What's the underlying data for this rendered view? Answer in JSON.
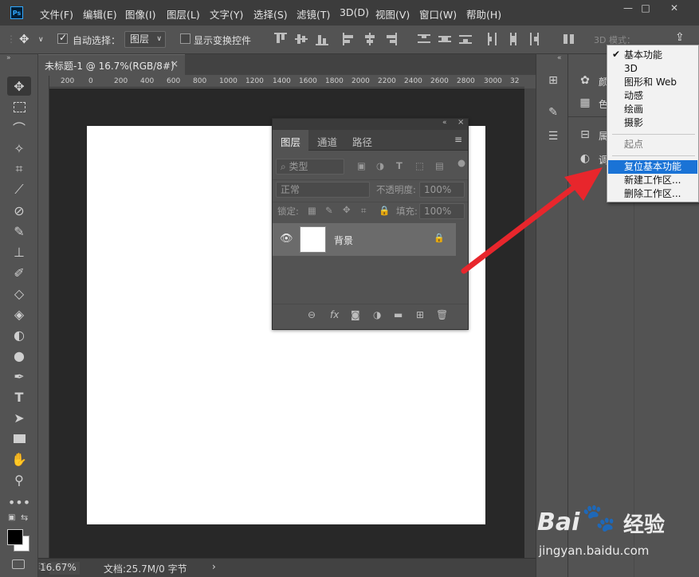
{
  "menubar": {
    "logo": "Ps",
    "items": [
      "文件(F)",
      "编辑(E)",
      "图像(I)",
      "图层(L)",
      "文字(Y)",
      "选择(S)",
      "滤镜(T)",
      "3D(D)",
      "视图(V)",
      "窗口(W)",
      "帮助(H)"
    ],
    "window_buttons": [
      "—",
      "□",
      "✕"
    ]
  },
  "options": {
    "auto_select_label": "自动选择：",
    "layer_select_value": "图层",
    "show_transform_label": "显示变换控件",
    "mode_3d_label": "3D 模式："
  },
  "document": {
    "tab_title": "未标题-1 @ 16.7%(RGB/8#)",
    "tab_close": "×",
    "ruler_ticks": [
      "200",
      "0",
      "200",
      "400",
      "600",
      "800",
      "1000",
      "1200",
      "1400",
      "1600",
      "1800",
      "2000",
      "2200",
      "2400",
      "2600",
      "2800",
      "3000",
      "32"
    ]
  },
  "status": {
    "zoom": "16.67%",
    "doc_info": "文档:25.7M/0 字节",
    "arrow": "›"
  },
  "layers_panel": {
    "tabs": [
      "图层",
      "通道",
      "路径"
    ],
    "filter_kind": "类型",
    "blend_mode": "正常",
    "opacity_label": "不透明度:",
    "opacity_value": "100%",
    "lock_label": "锁定:",
    "fill_label": "填充:",
    "fill_value": "100%",
    "layers": [
      {
        "name": "背景",
        "visible": true,
        "locked": true
      }
    ],
    "footer_icons": [
      "link-icon",
      "fx-icon",
      "mask-icon",
      "adjustment-icon",
      "folder-icon",
      "new-layer-icon",
      "trash-icon"
    ],
    "fx_text": "fx"
  },
  "right_panel": {
    "visible_labels": [
      "颜",
      "色",
      "属",
      "调"
    ]
  },
  "workspace_menu": {
    "items": [
      {
        "label": "基本功能",
        "checked": true
      },
      {
        "label": "3D"
      },
      {
        "label": "图形和 Web"
      },
      {
        "label": "动感"
      },
      {
        "label": "绘画"
      },
      {
        "label": "摄影"
      }
    ],
    "start_label": "起点",
    "reset_label": "复位基本功能",
    "new_label": "新建工作区...",
    "delete_label": "删除工作区..."
  },
  "watermark": {
    "brand": "Bai",
    "brand_cn": "经验",
    "url": "jingyan.baidu.com"
  },
  "colors": {
    "accent": "#31a8ff",
    "highlight": "#1a73d6",
    "arrow": "#e8262c"
  }
}
